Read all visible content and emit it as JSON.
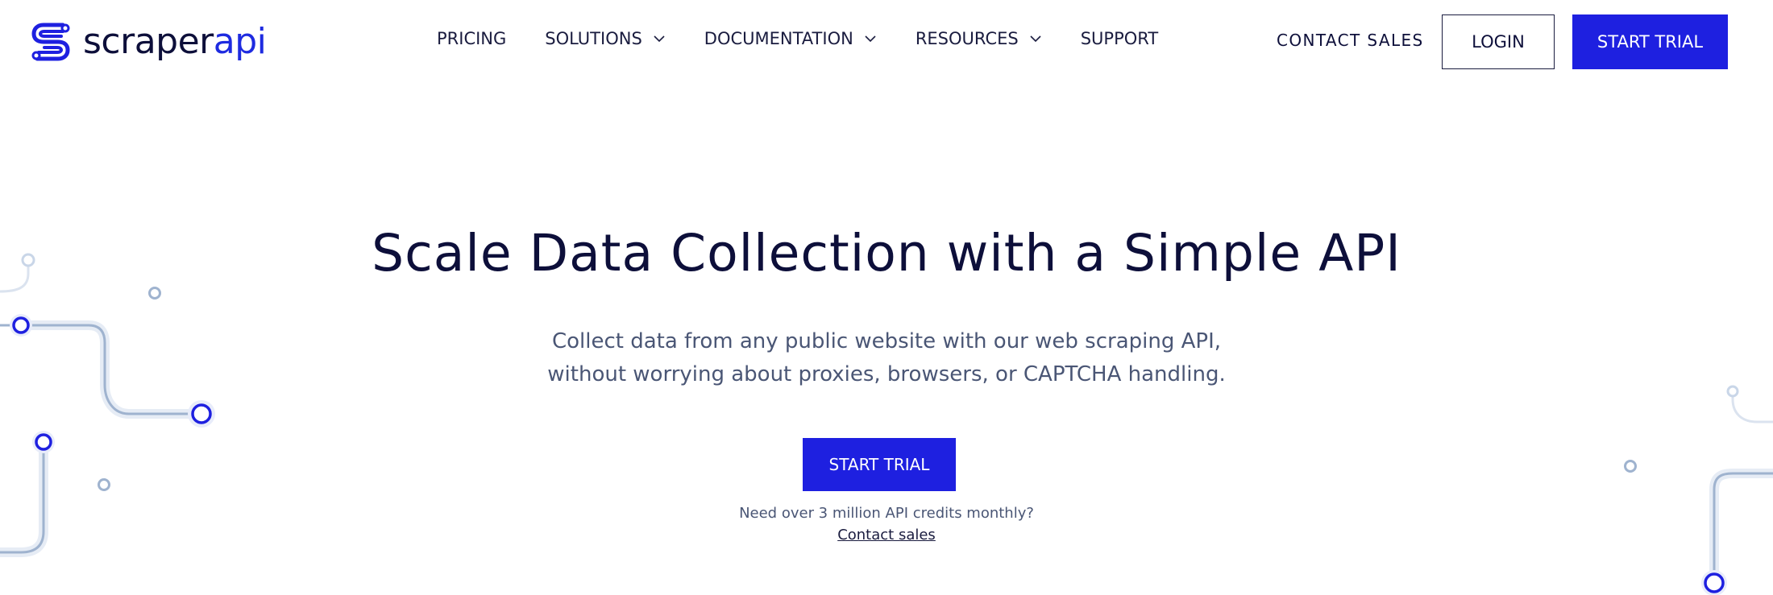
{
  "brand": {
    "name_part1": "scraper",
    "name_part2": "api",
    "primary_color": "#1e20e0",
    "text_color": "#0d0f3a"
  },
  "nav": {
    "items": [
      {
        "label": "PRICING",
        "has_dropdown": false
      },
      {
        "label": "SOLUTIONS",
        "has_dropdown": true
      },
      {
        "label": "DOCUMENTATION",
        "has_dropdown": true
      },
      {
        "label": "RESOURCES",
        "has_dropdown": true
      },
      {
        "label": "SUPPORT",
        "has_dropdown": false
      }
    ],
    "contact_sales": "CONTACT SALES",
    "login": "LOGIN",
    "start_trial": "START TRIAL"
  },
  "hero": {
    "title": "Scale Data Collection with a Simple API",
    "subtitle_line1": "Collect data from any public website with our web scraping API,",
    "subtitle_line2": "without worrying about proxies, browsers, or CAPTCHA handling.",
    "cta": "START TRIAL",
    "note": "Need over 3 million API credits monthly?",
    "link": "Contact sales"
  },
  "icons": {
    "logo": "scraperapi-logo-icon",
    "dropdown": "chevron-down-icon",
    "decoration": "circuit-line-decoration"
  }
}
